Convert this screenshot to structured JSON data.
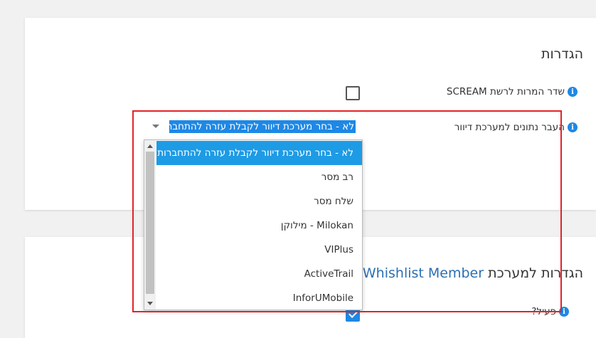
{
  "card1": {
    "title": "הגדרות",
    "scream_label": "שדר המרות לרשת SCREAM",
    "mailing_label": "העבר נתונים למערכת דיוור",
    "mailing_selected": "לא - בחר מערכת דיוור לקבלת עזרה להתחברות"
  },
  "dropdown": {
    "options": [
      "לא - בחר מערכת דיוור לקבלת עזרה להתחברות",
      "רב מסר",
      "שלח מסר",
      "Milokan - מילוקן",
      "VIPlus",
      "ActiveTrail",
      "InforUMobile"
    ]
  },
  "card2": {
    "title_prefix": "הגדרות למערכת ",
    "title_brand": "Whishlist Member",
    "active_label": "פעיל?"
  },
  "colors": {
    "accent": "#1e88e5",
    "highlight": "#e0242a"
  }
}
